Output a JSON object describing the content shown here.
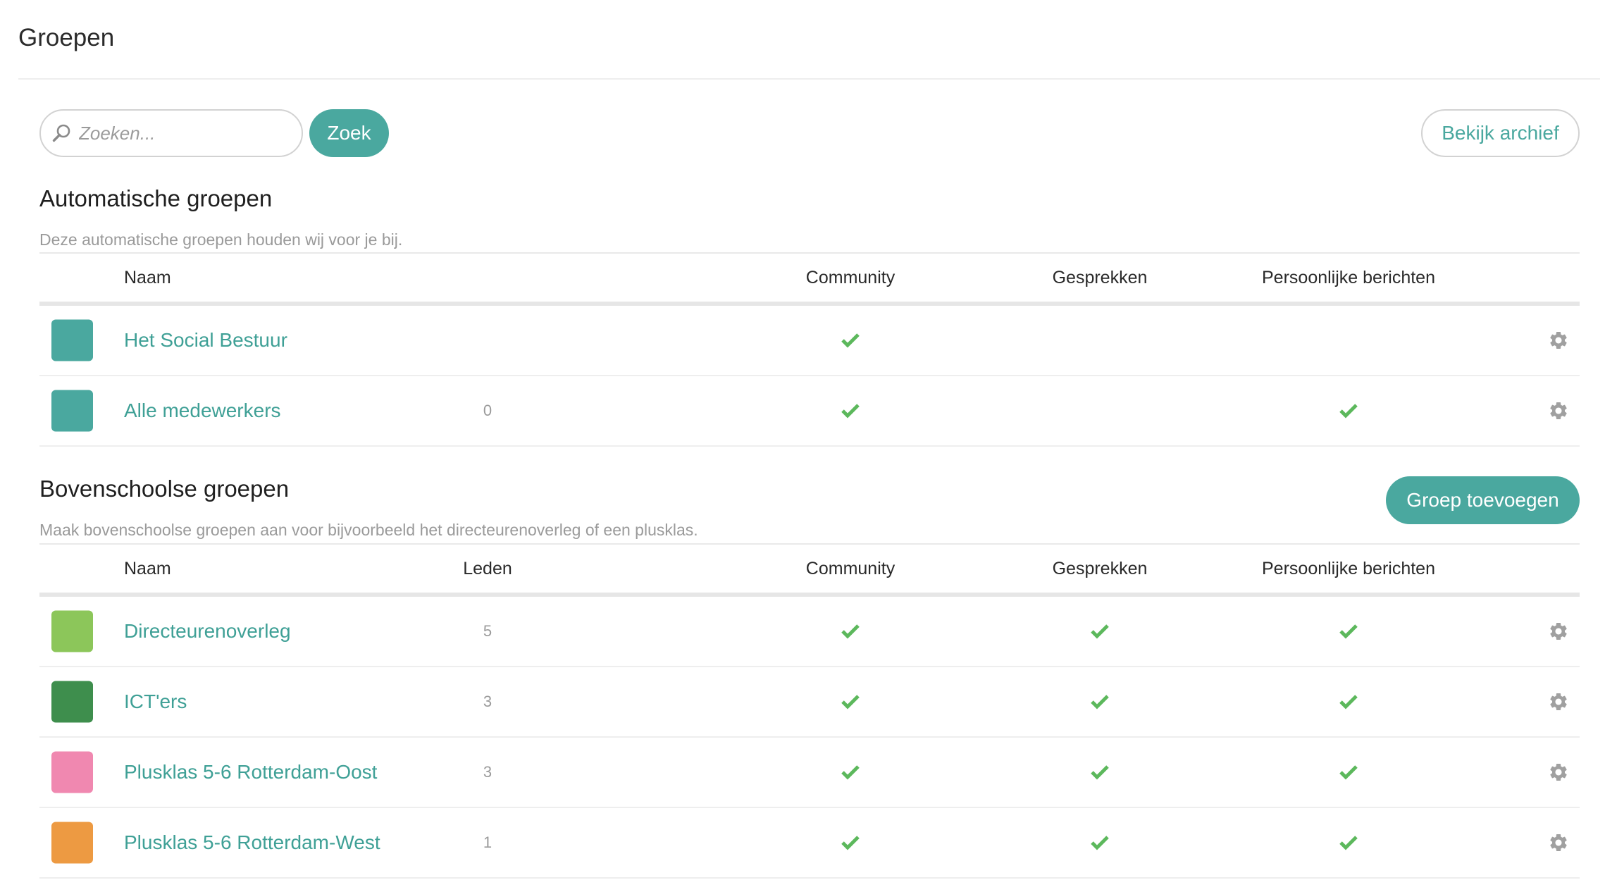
{
  "page": {
    "title": "Groepen"
  },
  "search": {
    "placeholder": "Zoeken...",
    "button_label": "Zoek"
  },
  "archive_button": {
    "label": "Bekijk archief"
  },
  "auto": {
    "heading": "Automatische groepen",
    "description": "Deze automatische groepen houden wij voor je bij.",
    "columns": {
      "naam": "Naam",
      "community": "Community",
      "gesprekken": "Gesprekken",
      "persoonlijk": "Persoonlijke berichten"
    },
    "rows": [
      {
        "name": "Het Social Bestuur",
        "color": "#4aa89f",
        "community": true,
        "gesprekken": false,
        "persoonlijk": false
      },
      {
        "name": "Alle medewerkers",
        "color": "#4aa89f",
        "leden": 0,
        "community": true,
        "gesprekken": false,
        "persoonlijk": true
      }
    ]
  },
  "bovenschools": {
    "heading": "Bovenschoolse groepen",
    "description": "Maak bovenschoolse groepen aan voor bijvoorbeeld het directeurenoverleg of een plusklas.",
    "add_button_label": "Groep toevoegen",
    "columns": {
      "naam": "Naam",
      "leden": "Leden",
      "community": "Community",
      "gesprekken": "Gesprekken",
      "persoonlijk": "Persoonlijke berichten"
    },
    "rows": [
      {
        "name": "Directeurenoverleg",
        "color": "#8cc65a",
        "leden": 5,
        "community": true,
        "gesprekken": true,
        "persoonlijk": true
      },
      {
        "name": "ICT'ers",
        "color": "#3e8e4d",
        "leden": 3,
        "community": true,
        "gesprekken": true,
        "persoonlijk": true
      },
      {
        "name": "Plusklas 5-6 Rotterdam-Oost",
        "color": "#f088b0",
        "leden": 3,
        "community": true,
        "gesprekken": true,
        "persoonlijk": true
      },
      {
        "name": "Plusklas 5-6 Rotterdam-West",
        "color": "#ed9a42",
        "leden": 1,
        "community": true,
        "gesprekken": true,
        "persoonlijk": true
      }
    ]
  },
  "icons": {
    "search": "search-icon",
    "check": "check-icon",
    "settings": "gear-icon"
  },
  "colors": {
    "accent": "#4aa89f",
    "link": "#3fa096",
    "check": "#5cb85c",
    "gear": "#a0a0a0",
    "muted_text": "#9a9a9a"
  }
}
